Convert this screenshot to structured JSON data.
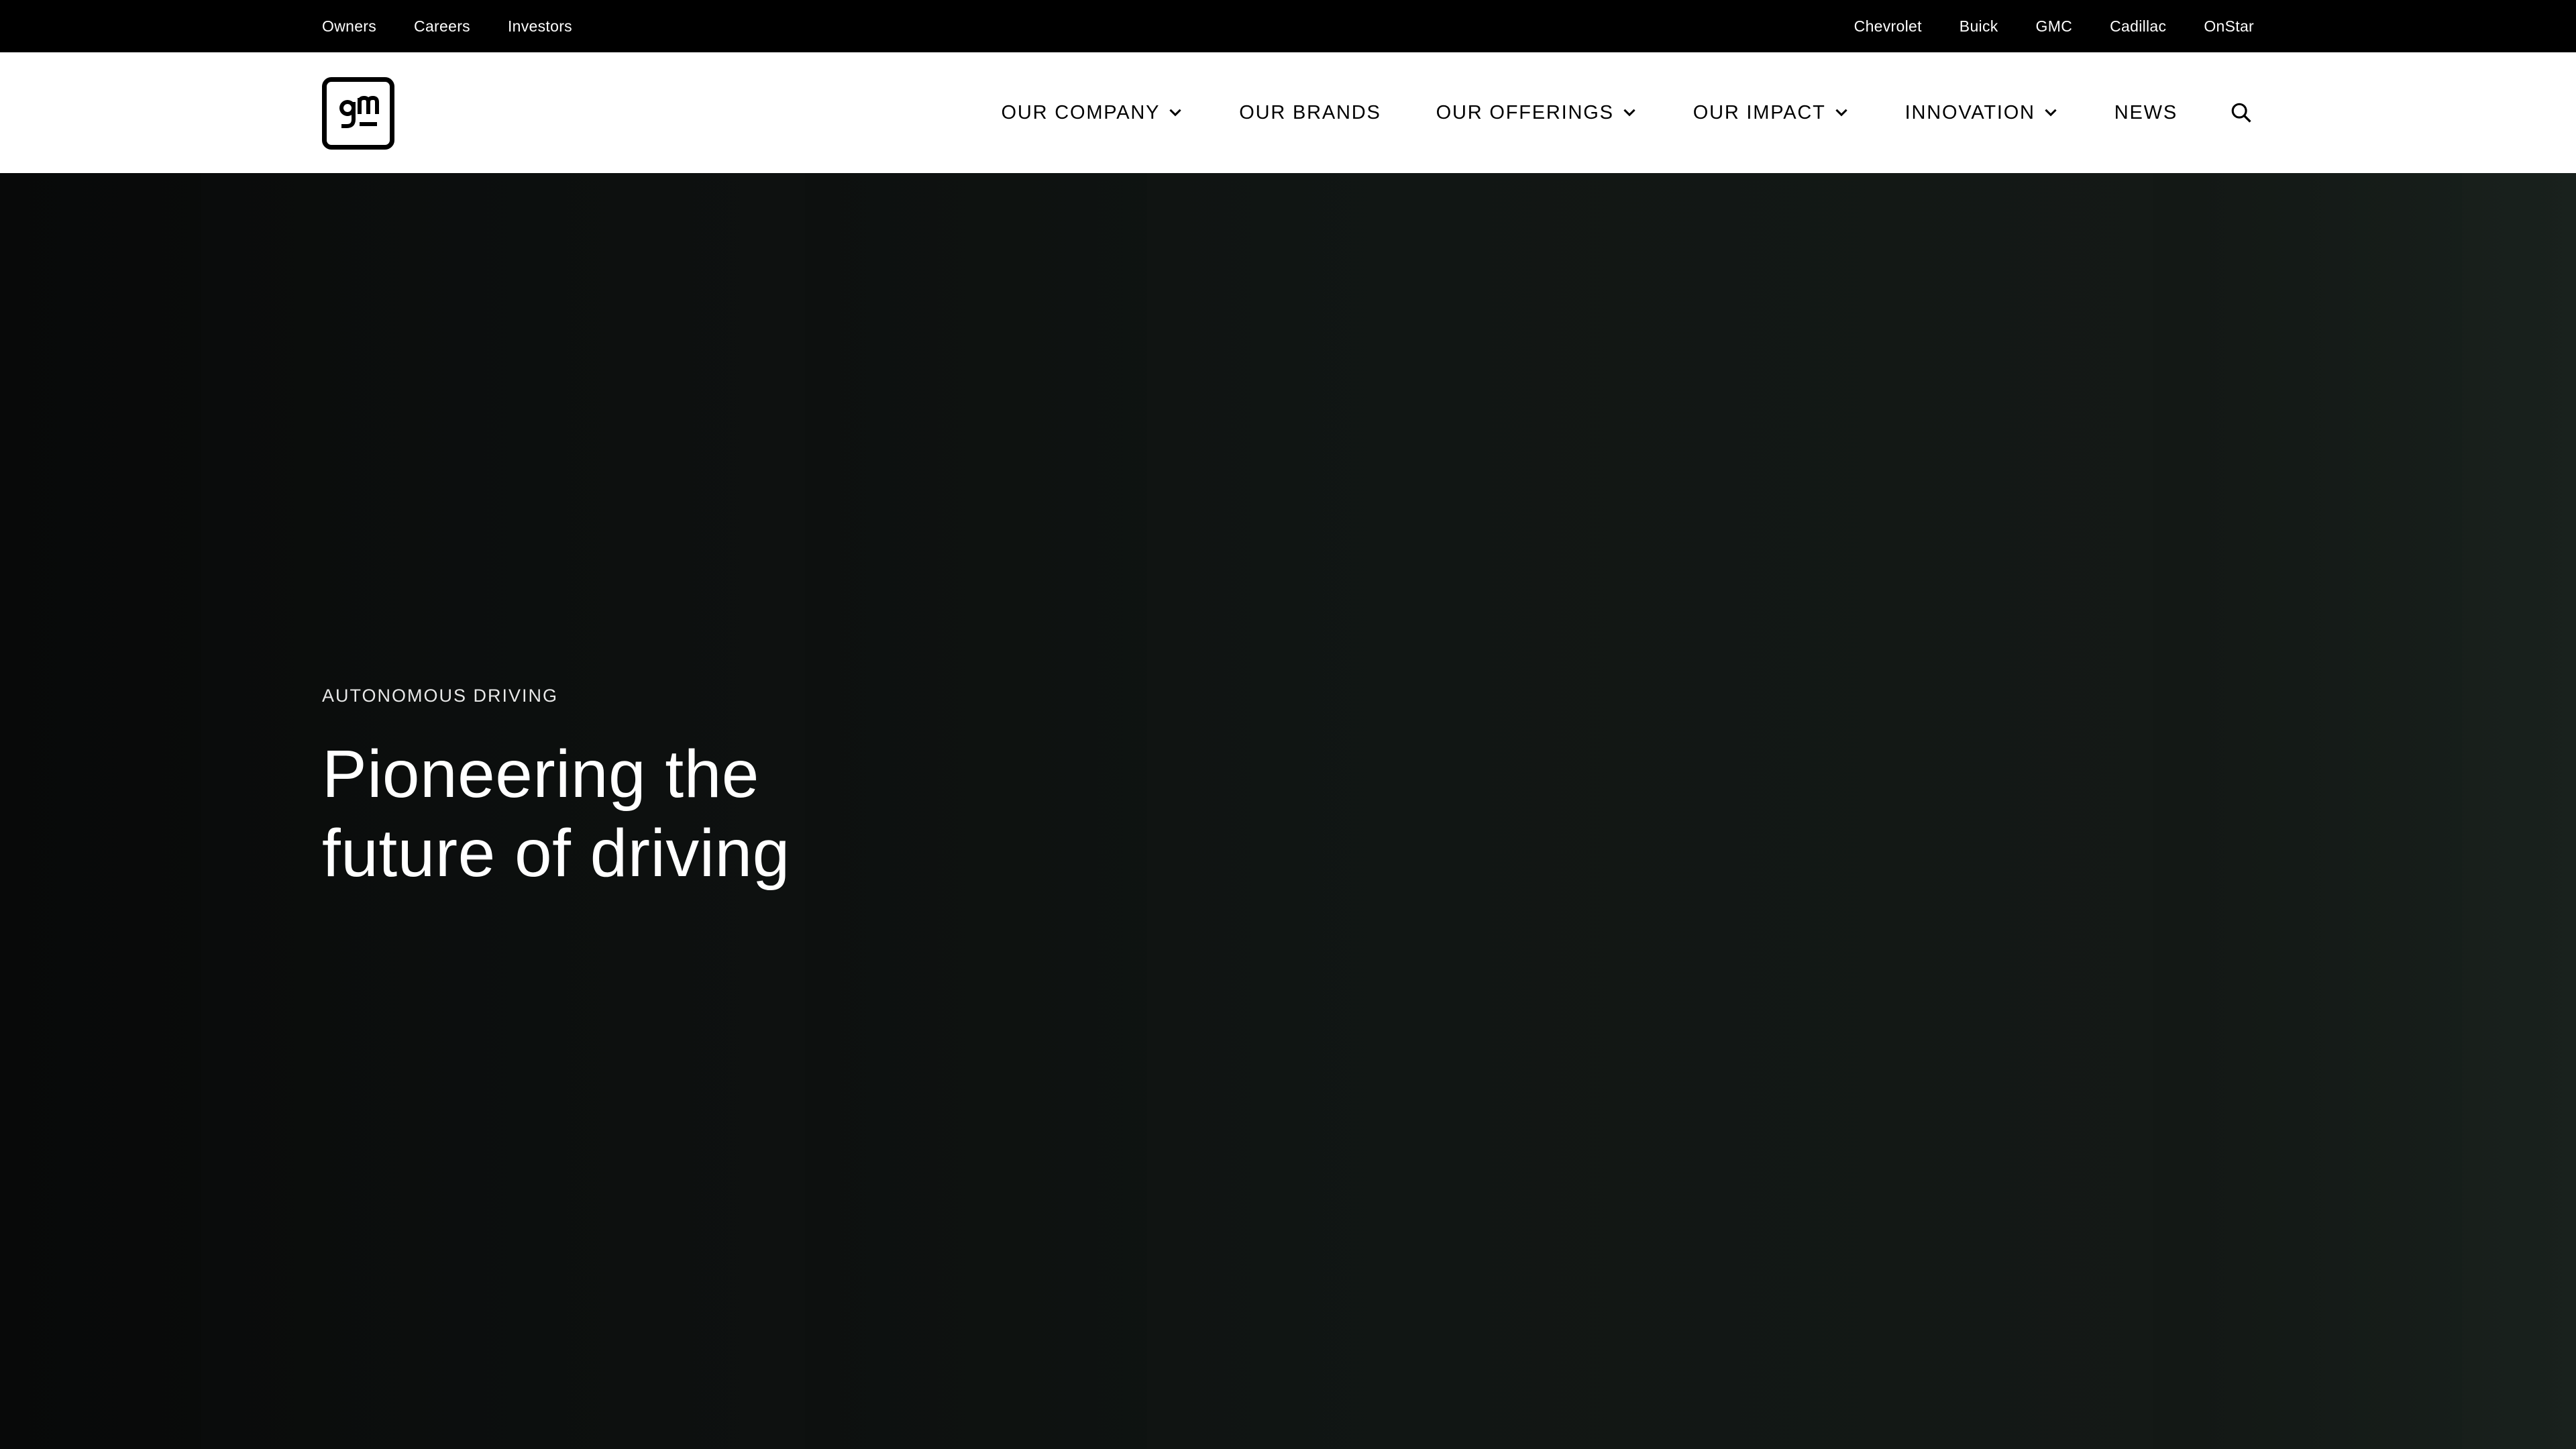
{
  "utility": {
    "left_links": [
      "Owners",
      "Careers",
      "Investors"
    ],
    "right_links": [
      "Chevrolet",
      "Buick",
      "GMC",
      "Cadillac",
      "OnStar"
    ]
  },
  "header": {
    "logo_text": "gm",
    "nav": [
      {
        "label": "OUR COMPANY",
        "has_dropdown": true
      },
      {
        "label": "OUR BRANDS",
        "has_dropdown": false
      },
      {
        "label": "OUR OFFERINGS",
        "has_dropdown": true
      },
      {
        "label": "OUR IMPACT",
        "has_dropdown": true
      },
      {
        "label": "INNOVATION",
        "has_dropdown": true
      },
      {
        "label": "NEWS",
        "has_dropdown": false
      }
    ],
    "search_icon": "search-icon"
  },
  "hero": {
    "eyebrow": "AUTONOMOUS DRIVING",
    "title": "Pioneering the future of driving"
  },
  "colors": {
    "utility_bg": "#000000",
    "header_bg": "#ffffff",
    "hero_bg": "#0e1110",
    "text_light": "#ffffff"
  }
}
